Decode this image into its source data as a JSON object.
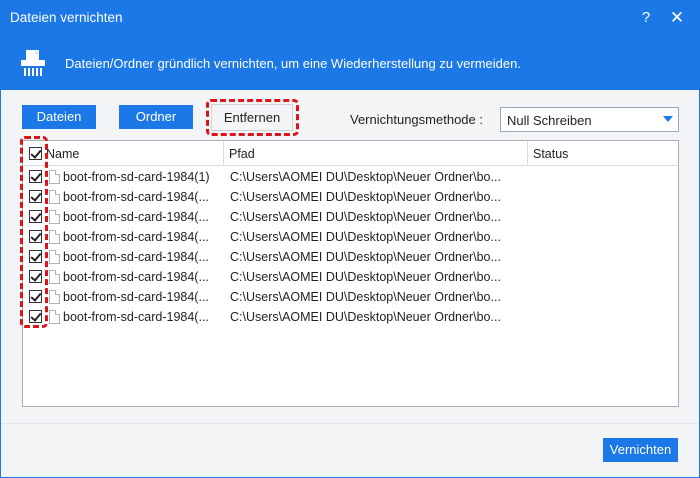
{
  "window": {
    "title": "Dateien vernichten",
    "help_label": "?",
    "close_label": "✕",
    "accent_color": "#1b78e6",
    "highlight_color": "#d9141a"
  },
  "banner": {
    "icon": "shredder-icon",
    "text": "Dateien/Ordner gründlich vernichten, um eine Wiederherstellung zu vermeiden."
  },
  "toolbar": {
    "dateien_label": "Dateien",
    "ordner_label": "Ordner",
    "entfernen_label": "Entfernen",
    "method_label": "Vernichtungsmethode :",
    "method_value": "Null Schreiben"
  },
  "table": {
    "columns": [
      "Name",
      "Pfad",
      "Status"
    ],
    "header_checked": true,
    "rows": [
      {
        "checked": true,
        "name": "boot-from-sd-card-1984(1)",
        "path": "C:\\Users\\AOMEI DU\\Desktop\\Neuer Ordner\\bo...",
        "status": ""
      },
      {
        "checked": true,
        "name": "boot-from-sd-card-1984(...",
        "path": "C:\\Users\\AOMEI DU\\Desktop\\Neuer Ordner\\bo...",
        "status": ""
      },
      {
        "checked": true,
        "name": "boot-from-sd-card-1984(...",
        "path": "C:\\Users\\AOMEI DU\\Desktop\\Neuer Ordner\\bo...",
        "status": ""
      },
      {
        "checked": true,
        "name": "boot-from-sd-card-1984(...",
        "path": "C:\\Users\\AOMEI DU\\Desktop\\Neuer Ordner\\bo...",
        "status": ""
      },
      {
        "checked": true,
        "name": "boot-from-sd-card-1984(...",
        "path": "C:\\Users\\AOMEI DU\\Desktop\\Neuer Ordner\\bo...",
        "status": ""
      },
      {
        "checked": true,
        "name": "boot-from-sd-card-1984(...",
        "path": "C:\\Users\\AOMEI DU\\Desktop\\Neuer Ordner\\bo...",
        "status": ""
      },
      {
        "checked": true,
        "name": "boot-from-sd-card-1984(...",
        "path": "C:\\Users\\AOMEI DU\\Desktop\\Neuer Ordner\\bo...",
        "status": ""
      },
      {
        "checked": true,
        "name": "boot-from-sd-card-1984(...",
        "path": "C:\\Users\\AOMEI DU\\Desktop\\Neuer Ordner\\bo...",
        "status": ""
      }
    ]
  },
  "footer": {
    "vernichten_label": "Vernichten"
  }
}
